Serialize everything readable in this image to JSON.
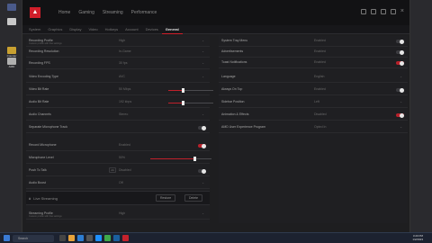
{
  "window": {
    "main_nav": [
      "Home",
      "Gaming",
      "Streaming",
      "Performance"
    ],
    "sub_tabs": [
      "System",
      "Graphics",
      "Display",
      "Video",
      "Hotkeys",
      "Account",
      "Devices",
      "General"
    ],
    "active_tab": "General"
  },
  "desktop_icons": [
    {
      "label": "",
      "color": "#4a5a8a"
    },
    {
      "label": "",
      "color": "#c9c9c9"
    },
    {
      "label": "Counter",
      "color": "#c8a030"
    },
    {
      "label": "AMD",
      "color": "#b0b0b0"
    }
  ],
  "left": {
    "rows": [
      {
        "label": "Recording Profile",
        "sub": "Custom profile with fine settings",
        "value": "High"
      },
      {
        "label": "Recording Resolution",
        "value": "In-Game"
      },
      {
        "label": "Recording FPS",
        "value": "30 fps"
      },
      {
        "label": "Video Encoding Type",
        "value": "AVC"
      },
      {
        "label": "Video Bit Rate",
        "value": "50 Mbps",
        "slider": 0.3
      },
      {
        "label": "Audio Bit Rate",
        "value": "192 kbps",
        "slider": 0.3
      },
      {
        "label": "Audio Channels",
        "value": "Stereo"
      },
      {
        "label": "Separate Microphone Track",
        "toggle": false
      }
    ],
    "mic_rows": [
      {
        "label": "Record Microphone",
        "value": "Enabled",
        "toggle": true
      },
      {
        "label": "Microphone Level",
        "value": "50%",
        "slider": 0.7
      },
      {
        "label": "Push To Talk",
        "value": "Disabled",
        "toggle": false,
        "key": "Alt"
      },
      {
        "label": "Audio Boost",
        "value": "Off"
      }
    ],
    "live_section": {
      "title": "Live Streaming",
      "buttons": [
        "Restore",
        "Delete"
      ]
    },
    "stream_rows": [
      {
        "label": "Streaming Profile",
        "sub": "Custom profile with fine settings",
        "value": "High"
      }
    ]
  },
  "right": {
    "rows": [
      {
        "label": "System Tray Menu",
        "value": "Enabled",
        "toggle": false
      },
      {
        "label": "Advertisements",
        "value": "Enabled",
        "toggle": false
      },
      {
        "label": "Toast Notifications",
        "value": "Enabled",
        "toggle": true
      },
      {
        "label": "Language",
        "value": "English"
      },
      {
        "label": "Always On Top",
        "value": "Enabled",
        "toggle": false
      },
      {
        "label": "Sidebar Position",
        "value": "Left"
      },
      {
        "label": "Animation & Effects",
        "value": "Disabled",
        "toggle": true
      },
      {
        "label": "AMD User Experience Program",
        "value": "Opted In"
      }
    ]
  },
  "taskbar": {
    "search_placeholder": "Search",
    "time": "3:20 PM",
    "date": "1/2/2023"
  },
  "colors": {
    "accent": "#d01e2a",
    "bg": "#1e1e20"
  }
}
